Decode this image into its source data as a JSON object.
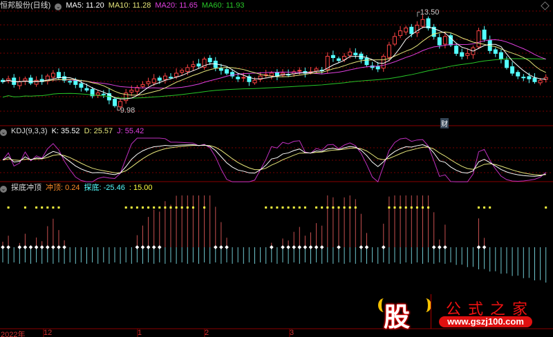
{
  "header": {
    "stock": "恒邦股份(日线)",
    "ma5": "MA5: 11.20",
    "ma10": "MA10: 11.28",
    "ma20": "MA20: 11.65",
    "ma60": "MA60: 11.93"
  },
  "kdj_header": {
    "name": "KDJ(9,3,3)",
    "k": "K: 35.52",
    "d": "D: 25.57",
    "j": "J: 55.42"
  },
  "ind_header": {
    "name": "探底冲顶",
    "chongding": "冲顶: 0.24",
    "tandi": "探底: -25.46",
    "extra": ": 15.00"
  },
  "annotations": {
    "high": "13.50",
    "low": "9.98",
    "cai": "财"
  },
  "x_axis": {
    "year": "2022年",
    "m12": "12",
    "m1": "1",
    "m2": "2",
    "m3": "3"
  },
  "logo": {
    "char": "股",
    "text": "公式之家",
    "url": "www.gszj100.com"
  },
  "colors": {
    "up": "#ff4444",
    "down": "#54ffff",
    "ma5": "#ffffff",
    "ma10": "#e6e67a",
    "ma20": "#e040e0",
    "ma60": "#28c828",
    "grid": "#7a0000"
  },
  "chart_data": {
    "type": "candlestick",
    "title": "恒邦股份(日线)",
    "ylim": [
      9.98,
      13.5
    ],
    "closes": [
      11.0,
      11.1,
      10.9,
      11.0,
      11.1,
      10.95,
      11.05,
      11.0,
      11.2,
      11.3,
      11.15,
      11.05,
      11.0,
      10.9,
      10.8,
      10.7,
      10.5,
      10.6,
      10.55,
      10.35,
      10.15,
      10.3,
      10.6,
      10.7,
      10.8,
      10.9,
      11.0,
      11.1,
      11.05,
      11.2,
      11.15,
      11.3,
      11.4,
      11.5,
      11.6,
      11.55,
      11.8,
      11.7,
      11.5,
      11.4,
      11.3,
      11.2,
      11.1,
      11.15,
      11.0,
      11.05,
      11.2,
      11.25,
      11.3,
      11.2,
      11.3,
      11.25,
      11.35,
      11.4,
      11.3,
      11.35,
      11.45,
      11.4,
      11.9,
      11.85,
      11.75,
      11.9,
      12.05,
      11.95,
      11.8,
      11.6,
      11.5,
      11.45,
      11.9,
      12.3,
      12.6,
      12.8,
      12.9,
      12.7,
      13.0,
      13.2,
      12.9,
      12.6,
      12.3,
      12.6,
      12.3,
      12.0,
      11.9,
      12.0,
      12.2,
      12.8,
      12.5,
      12.1,
      12.0,
      11.8,
      11.5,
      11.3,
      11.2,
      11.15,
      11.1,
      11.0,
      11.05,
      11.15
    ],
    "series": [
      "MA5",
      "MA10",
      "MA20",
      "MA60",
      "K",
      "D",
      "J",
      "冲顶",
      "探底"
    ]
  }
}
